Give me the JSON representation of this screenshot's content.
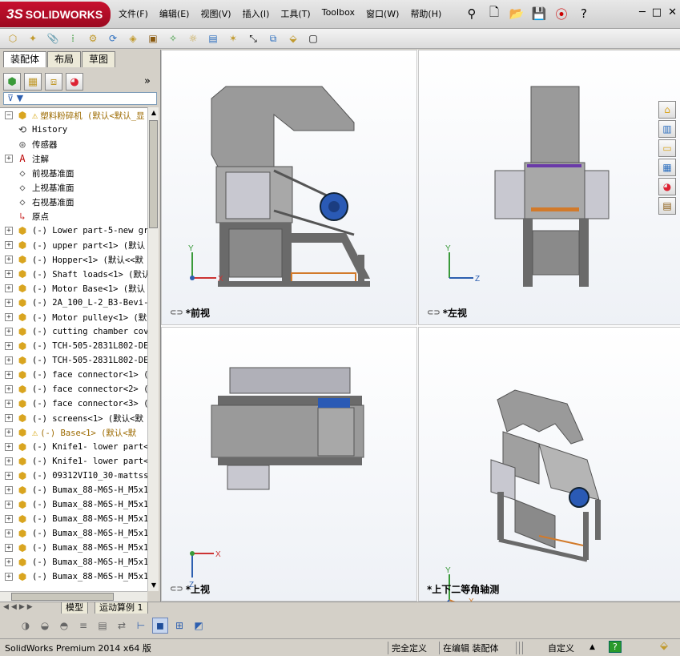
{
  "app": {
    "logo_prefix": "3S",
    "logo_text": "SOLIDWORKS"
  },
  "menu": [
    "文件(F)",
    "编辑(E)",
    "视图(V)",
    "插入(I)",
    "工具(T)",
    "Toolbox",
    "窗口(W)",
    "帮助(H)"
  ],
  "titlebar_icons": [
    "pin-icon",
    "new-document-icon",
    "open-folder-icon",
    "save-icon",
    "traffic-light-icon",
    "help-icon"
  ],
  "window_controls": [
    "─",
    "□",
    "✕"
  ],
  "feature_manager": {
    "tabs": [
      "装配体",
      "布局",
      "草图"
    ],
    "active_tab": 0,
    "filter_symbol": "▼",
    "expand_symbol": "»",
    "tree": [
      {
        "label": "塑料粉碎机  (默认<默认_显",
        "icon": "assembly-icon",
        "warning": true,
        "root": true,
        "expander": "−"
      },
      {
        "label": "History",
        "icon": "history-icon",
        "expander": ""
      },
      {
        "label": "传感器",
        "icon": "sensor-icon",
        "expander": ""
      },
      {
        "label": "注解",
        "icon": "annotation-icon",
        "expander": "+"
      },
      {
        "label": "前视基准面",
        "icon": "plane-icon",
        "expander": ""
      },
      {
        "label": "上视基准面",
        "icon": "plane-icon",
        "expander": ""
      },
      {
        "label": "右视基准面",
        "icon": "plane-icon",
        "expander": ""
      },
      {
        "label": "原点",
        "icon": "origin-icon",
        "expander": ""
      },
      {
        "label": "(-) Lower part-5-new gr",
        "icon": "part-icon",
        "expander": "+"
      },
      {
        "label": "(-) upper part<1> (默认",
        "icon": "part-icon",
        "expander": "+"
      },
      {
        "label": "(-) Hopper<1> (默认<<默",
        "icon": "part-icon",
        "expander": "+"
      },
      {
        "label": "(-) Shaft loads<1> (默认",
        "icon": "part-icon",
        "expander": "+"
      },
      {
        "label": "(-) Motor Base<1> (默认",
        "icon": "part-icon",
        "expander": "+"
      },
      {
        "label": "(-) 2A_100_L-2_B3-Bevi-",
        "icon": "part-icon",
        "expander": "+"
      },
      {
        "label": "(-) Motor pulley<1> (默",
        "icon": "part-icon",
        "expander": "+"
      },
      {
        "label": "(-) cutting chamber cov",
        "icon": "part-icon",
        "expander": "+"
      },
      {
        "label": "(-) TCH-505-2831L802-DE",
        "icon": "part-icon",
        "expander": "+"
      },
      {
        "label": "(-) TCH-505-2831L802-DE",
        "icon": "part-icon",
        "expander": "+"
      },
      {
        "label": "(-) face connector<1> (",
        "icon": "part-icon",
        "expander": "+"
      },
      {
        "label": "(-) face connector<2> (",
        "icon": "part-icon",
        "expander": "+"
      },
      {
        "label": "(-) face connector<3> (",
        "icon": "part-icon",
        "expander": "+"
      },
      {
        "label": "(-) screens<1> (默认<默",
        "icon": "part-icon",
        "expander": "+"
      },
      {
        "label": "(-) Base<1> (默认<默",
        "icon": "part-icon",
        "warning": true,
        "expander": "+"
      },
      {
        "label": "(-) Knife1- lower part<",
        "icon": "part-icon",
        "expander": "+"
      },
      {
        "label": "(-) Knife1- lower part<",
        "icon": "part-icon",
        "expander": "+"
      },
      {
        "label": "(-) 09312VI10_30-mattss",
        "icon": "part-icon",
        "expander": "+"
      },
      {
        "label": "(-) Bumax_88-M6S-H_M5x1",
        "icon": "part-icon",
        "expander": "+"
      },
      {
        "label": "(-) Bumax_88-M6S-H_M5x1",
        "icon": "part-icon",
        "expander": "+"
      },
      {
        "label": "(-) Bumax_88-M6S-H_M5x1",
        "icon": "part-icon",
        "expander": "+"
      },
      {
        "label": "(-) Bumax_88-M6S-H_M5x1",
        "icon": "part-icon",
        "expander": "+"
      },
      {
        "label": "(-) Bumax_88-M6S-H_M5x1",
        "icon": "part-icon",
        "expander": "+"
      },
      {
        "label": "(-) Bumax_88-M6S-H_M5x1",
        "icon": "part-icon",
        "expander": "+"
      },
      {
        "label": "(-) Bumax_88-M6S-H_M5x1",
        "icon": "part-icon",
        "expander": "+"
      }
    ]
  },
  "viewports": [
    {
      "label": "*前视",
      "axes": [
        "Y",
        "X"
      ]
    },
    {
      "label": "*左视",
      "axes": [
        "Y",
        "Z"
      ]
    },
    {
      "label": "*上视",
      "axes": [
        "X",
        "Z"
      ]
    },
    {
      "label": "*上下二等角轴测",
      "axes": [
        "Y",
        "X",
        "Z"
      ]
    }
  ],
  "bottom_tabs": [
    "模型",
    "运动算例 1"
  ],
  "status": {
    "version": "SolidWorks Premium 2014 x64 版",
    "definition": "完全定义",
    "mode": "在编辑 装配体",
    "units": "自定义",
    "units_arrow": "▲",
    "help": "?"
  },
  "colors": {
    "machine_gray": "#8f8f8f",
    "motor_blue": "#2a5ab5",
    "frame_dark": "#6a6a6a",
    "accent_orange": "#d27a2a"
  }
}
